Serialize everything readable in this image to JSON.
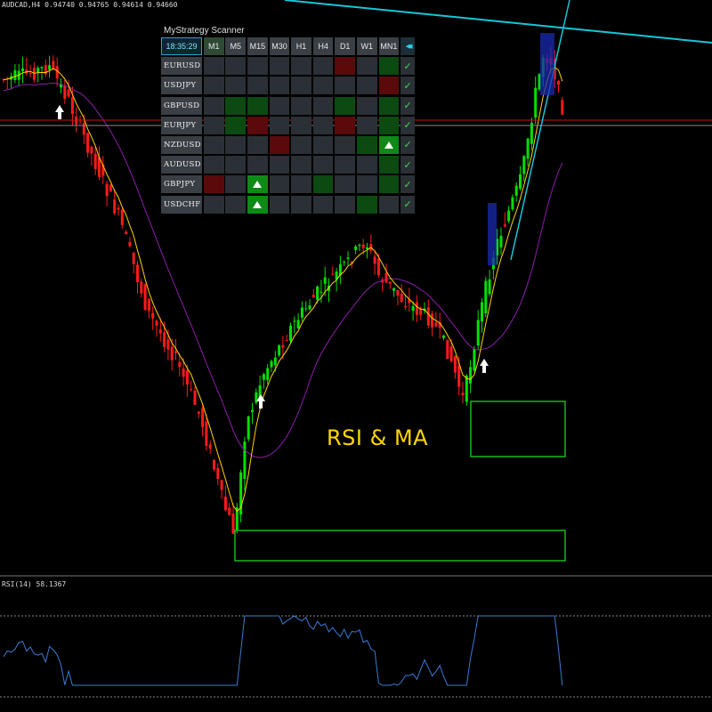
{
  "chart": {
    "header": "AUDCAD,H4  0.94740  0.94765  0.94614  0.94660",
    "overlay_text": "RSI & MA",
    "rsi_header": "RSI(14) 58.1367",
    "colors": {
      "bull_candle": "#00e000",
      "bear_candle": "#ff1a1a",
      "ma_fast": "#ffd400",
      "ma_slow": "#8b1ea8",
      "rsi_line": "#3a7bd5",
      "trend_line": "#19c5d8",
      "price_line": "#cc1111",
      "zone_box": "#18b818"
    }
  },
  "scanner": {
    "title": "MyStrategy Scanner",
    "time": "18:35:29",
    "timeframes": [
      "M1",
      "M5",
      "M15",
      "M30",
      "H1",
      "H4",
      "D1",
      "W1",
      "MN1"
    ],
    "nav_icon": "double-chevron-left",
    "check_icon": "check-mark",
    "rows": [
      {
        "symbol": "EURUSD",
        "cells": [
          "n",
          "n",
          "n",
          "n",
          "n",
          "n",
          "r",
          "n",
          "g"
        ]
      },
      {
        "symbol": "USDJPY",
        "cells": [
          "n",
          "n",
          "n",
          "n",
          "n",
          "n",
          "n",
          "n",
          "r"
        ]
      },
      {
        "symbol": "GBPUSD",
        "cells": [
          "n",
          "g",
          "g",
          "n",
          "n",
          "n",
          "g",
          "n",
          "g"
        ]
      },
      {
        "symbol": "EURJPY",
        "cells": [
          "n",
          "g",
          "r",
          "n",
          "n",
          "n",
          "r",
          "n",
          "g"
        ]
      },
      {
        "symbol": "NZDUSD",
        "cells": [
          "n",
          "n",
          "n",
          "r",
          "n",
          "n",
          "n",
          "g",
          "buy"
        ]
      },
      {
        "symbol": "AUDUSD",
        "cells": [
          "n",
          "n",
          "n",
          "n",
          "n",
          "n",
          "n",
          "n",
          "g"
        ]
      },
      {
        "symbol": "GBPJPY",
        "cells": [
          "r",
          "n",
          "buy",
          "n",
          "n",
          "g",
          "n",
          "n",
          "g"
        ]
      },
      {
        "symbol": "USDCHF",
        "cells": [
          "n",
          "n",
          "buy",
          "n",
          "n",
          "n",
          "n",
          "g",
          "n"
        ]
      }
    ]
  }
}
